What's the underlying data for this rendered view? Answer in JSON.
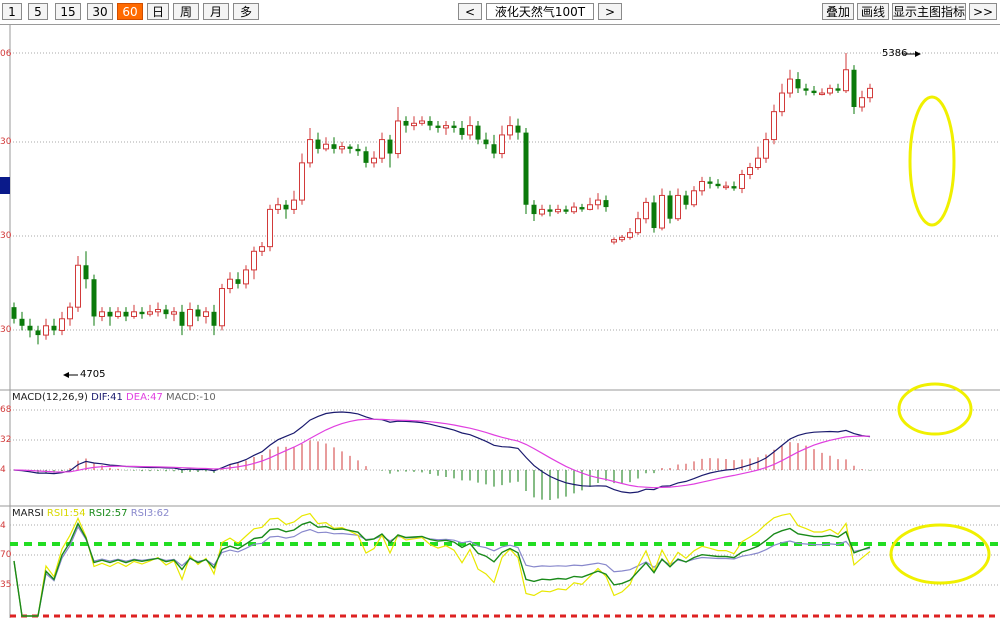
{
  "toolbar": {
    "periods": [
      "1",
      "5",
      "15",
      "30",
      "60",
      "日",
      "周",
      "月",
      "多"
    ],
    "active_period": "60",
    "prev_label": "<",
    "next_label": ">",
    "instrument": "液化天然气100T",
    "overlay_label": "叠加",
    "draw_label": "画线",
    "main_indicator_label": "显示主图指标",
    "more_label": ">>"
  },
  "colors": {
    "up": "#d23a3a",
    "down": "#0b7a0b",
    "active_tab": "#ff6a00",
    "highlight": "#f0f000",
    "dif": "#1a1a6e",
    "dea": "#e040e0",
    "rsi1": "#e8e800",
    "rsi2": "#1a8a1a",
    "rsi3": "#8888cc"
  },
  "main_panel": {
    "y_ticks": [
      "06",
      "30",
      "30",
      "30"
    ],
    "high_label": "5386",
    "low_label": "4705"
  },
  "macd_panel": {
    "name": "MACD(12,26,9)",
    "dif": "DIF:41",
    "dea": "DEA:47",
    "macd": "MACD:-10",
    "y_ticks": [
      "68",
      "32",
      "4"
    ]
  },
  "rsi_panel": {
    "name": "MARSI",
    "rsi1": "RSI1:54",
    "rsi2": "RSI2:57",
    "rsi3": "RSI3:62",
    "y_ticks": [
      "4",
      "70",
      "35"
    ]
  },
  "chart_data": {
    "type": "candlestick",
    "instrument": "液化天然气100T",
    "period": "60",
    "price_high": 5386,
    "price_low": 4705,
    "candles": [
      [
        4840,
        4815,
        4850,
        4805
      ],
      [
        4815,
        4800,
        4830,
        4790
      ],
      [
        4800,
        4790,
        4815,
        4775
      ],
      [
        4790,
        4780,
        4800,
        4760
      ],
      [
        4780,
        4800,
        4815,
        4770
      ],
      [
        4800,
        4790,
        4815,
        4780
      ],
      [
        4790,
        4815,
        4830,
        4780
      ],
      [
        4815,
        4840,
        4850,
        4800
      ],
      [
        4840,
        4930,
        4950,
        4830
      ],
      [
        4930,
        4900,
        4960,
        4880
      ],
      [
        4900,
        4820,
        4910,
        4800
      ],
      [
        4820,
        4830,
        4840,
        4810
      ],
      [
        4830,
        4820,
        4840,
        4800
      ],
      [
        4820,
        4830,
        4840,
        4815
      ],
      [
        4830,
        4820,
        4840,
        4810
      ],
      [
        4820,
        4830,
        4845,
        4815
      ],
      [
        4830,
        4825,
        4840,
        4815
      ],
      [
        4825,
        4830,
        4845,
        4820
      ],
      [
        4830,
        4835,
        4850,
        4820
      ],
      [
        4835,
        4825,
        4845,
        4815
      ],
      [
        4825,
        4830,
        4840,
        4810
      ],
      [
        4830,
        4800,
        4845,
        4780
      ],
      [
        4800,
        4835,
        4850,
        4790
      ],
      [
        4835,
        4820,
        4845,
        4810
      ],
      [
        4820,
        4830,
        4840,
        4805
      ],
      [
        4830,
        4800,
        4845,
        4780
      ],
      [
        4800,
        4880,
        4890,
        4790
      ],
      [
        4880,
        4900,
        4915,
        4870
      ],
      [
        4900,
        4890,
        4915,
        4880
      ],
      [
        4890,
        4920,
        4930,
        4880
      ],
      [
        4920,
        4960,
        4970,
        4900
      ],
      [
        4960,
        4970,
        4980,
        4950
      ],
      [
        4970,
        5050,
        5060,
        4960
      ],
      [
        5050,
        5060,
        5075,
        5040
      ],
      [
        5060,
        5050,
        5070,
        5030
      ],
      [
        5050,
        5070,
        5090,
        5040
      ],
      [
        5070,
        5150,
        5170,
        5060
      ],
      [
        5150,
        5200,
        5225,
        5140
      ],
      [
        5200,
        5180,
        5215,
        5170
      ],
      [
        5180,
        5190,
        5205,
        5175
      ],
      [
        5190,
        5180,
        5205,
        5170
      ],
      [
        5180,
        5185,
        5195,
        5170
      ],
      [
        5185,
        5180,
        5190,
        5170
      ],
      [
        5180,
        5175,
        5190,
        5165
      ],
      [
        5175,
        5150,
        5185,
        5140
      ],
      [
        5150,
        5160,
        5175,
        5140
      ],
      [
        5160,
        5200,
        5215,
        5150
      ],
      [
        5200,
        5170,
        5210,
        5140
      ],
      [
        5170,
        5240,
        5270,
        5160
      ],
      [
        5240,
        5230,
        5250,
        5215
      ],
      [
        5230,
        5235,
        5250,
        5220
      ],
      [
        5235,
        5240,
        5250,
        5230
      ],
      [
        5240,
        5230,
        5250,
        5220
      ],
      [
        5230,
        5225,
        5240,
        5215
      ],
      [
        5225,
        5230,
        5240,
        5210
      ],
      [
        5230,
        5225,
        5240,
        5215
      ],
      [
        5225,
        5210,
        5240,
        5200
      ],
      [
        5210,
        5230,
        5250,
        5200
      ],
      [
        5230,
        5200,
        5240,
        5190
      ],
      [
        5200,
        5190,
        5215,
        5180
      ],
      [
        5190,
        5170,
        5210,
        5160
      ],
      [
        5170,
        5210,
        5230,
        5160
      ],
      [
        5210,
        5230,
        5250,
        5200
      ],
      [
        5230,
        5215,
        5245,
        5200
      ],
      [
        5215,
        5060,
        5225,
        5040
      ],
      [
        5060,
        5040,
        5070,
        5025
      ],
      [
        5040,
        5050,
        5060,
        5035
      ],
      [
        5050,
        5045,
        5060,
        5035
      ],
      [
        5045,
        5050,
        5060,
        5040
      ],
      [
        5050,
        5045,
        5058,
        5040
      ],
      [
        5045,
        5055,
        5065,
        5040
      ],
      [
        5055,
        5050,
        5062,
        5045
      ],
      [
        5050,
        5060,
        5075,
        5048
      ],
      [
        5060,
        5070,
        5085,
        5050
      ],
      [
        5070,
        5055,
        5080,
        5045
      ],
      [
        4980,
        4985,
        4990,
        4975
      ],
      [
        4985,
        4990,
        4995,
        4980
      ],
      [
        4990,
        5000,
        5010,
        4985
      ],
      [
        5000,
        5030,
        5045,
        4995
      ],
      [
        5030,
        5065,
        5075,
        5020
      ],
      [
        5065,
        5010,
        5080,
        5000
      ],
      [
        5010,
        5080,
        5095,
        5005
      ],
      [
        5080,
        5030,
        5090,
        5020
      ],
      [
        5030,
        5080,
        5095,
        5025
      ],
      [
        5080,
        5060,
        5090,
        5050
      ],
      [
        5060,
        5090,
        5100,
        5055
      ],
      [
        5090,
        5110,
        5120,
        5080
      ],
      [
        5110,
        5105,
        5120,
        5095
      ],
      [
        5105,
        5100,
        5115,
        5095
      ],
      [
        5100,
        5100,
        5110,
        5092
      ],
      [
        5100,
        5095,
        5110,
        5090
      ],
      [
        5095,
        5125,
        5135,
        5085
      ],
      [
        5125,
        5140,
        5150,
        5115
      ],
      [
        5140,
        5160,
        5185,
        5135
      ],
      [
        5160,
        5200,
        5215,
        5150
      ],
      [
        5200,
        5260,
        5275,
        5190
      ],
      [
        5260,
        5300,
        5320,
        5250
      ],
      [
        5300,
        5330,
        5350,
        5290
      ],
      [
        5330,
        5310,
        5345,
        5300
      ],
      [
        5310,
        5305,
        5320,
        5295
      ],
      [
        5305,
        5300,
        5315,
        5295
      ],
      [
        5300,
        5300,
        5310,
        5295
      ],
      [
        5300,
        5310,
        5318,
        5295
      ],
      [
        5310,
        5305,
        5320,
        5300
      ],
      [
        5305,
        5350,
        5386,
        5300
      ],
      [
        5350,
        5270,
        5360,
        5255
      ],
      [
        5270,
        5290,
        5305,
        5260
      ],
      [
        5290,
        5310,
        5320,
        5280
      ]
    ]
  }
}
